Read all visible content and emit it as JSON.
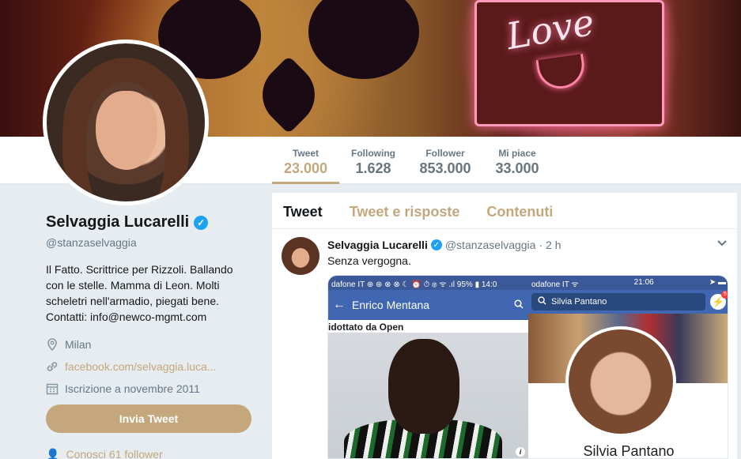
{
  "stats": [
    {
      "label": "Tweet",
      "value": "23.000"
    },
    {
      "label": "Following",
      "value": "1.628"
    },
    {
      "label": "Follower",
      "value": "853.000"
    },
    {
      "label": "Mi piace",
      "value": "33.000"
    }
  ],
  "profile": {
    "name": "Selvaggia Lucarelli",
    "handle": "@stanzaselvaggia",
    "bio": "Il Fatto. Scrittrice per Rizzoli. Ballando con le stelle. Mamma di Leon. Molti scheletri nell'armadio, piegati bene. Contatti: info@newco-mgmt.com",
    "location": "Milan",
    "link": "facebook.com/selvaggia.luca...",
    "joined": "Iscrizione a novembre 2011",
    "tweet_button": "Invia Tweet",
    "followers_known": "Conosci 61 follower"
  },
  "tabs": [
    "Tweet",
    "Tweet e risposte",
    "Contenuti"
  ],
  "tweet": {
    "name": "Selvaggia Lucarelli",
    "handle": "@stanzaselvaggia",
    "time": "· 2 h",
    "text": "Senza vergogna.",
    "media_left": {
      "status": "dafone IT ⊕ ⊛ ⊗ ⊗   ☾ ⏰ ⏱ ⊛ ᯤ .ıl 95% ▮ 14:0",
      "title": "Enrico Mentana",
      "subtitle": "idottato  da Open"
    },
    "media_right": {
      "status_left": "odafone IT ᯤ",
      "status_time": "21:06",
      "search": "Silvia Pantano",
      "badge": "5",
      "name": "Silvia Pantano"
    }
  },
  "colors": {
    "accent": "#c4a77c",
    "verified": "#1da1f2",
    "facebook": "#4267b2"
  }
}
